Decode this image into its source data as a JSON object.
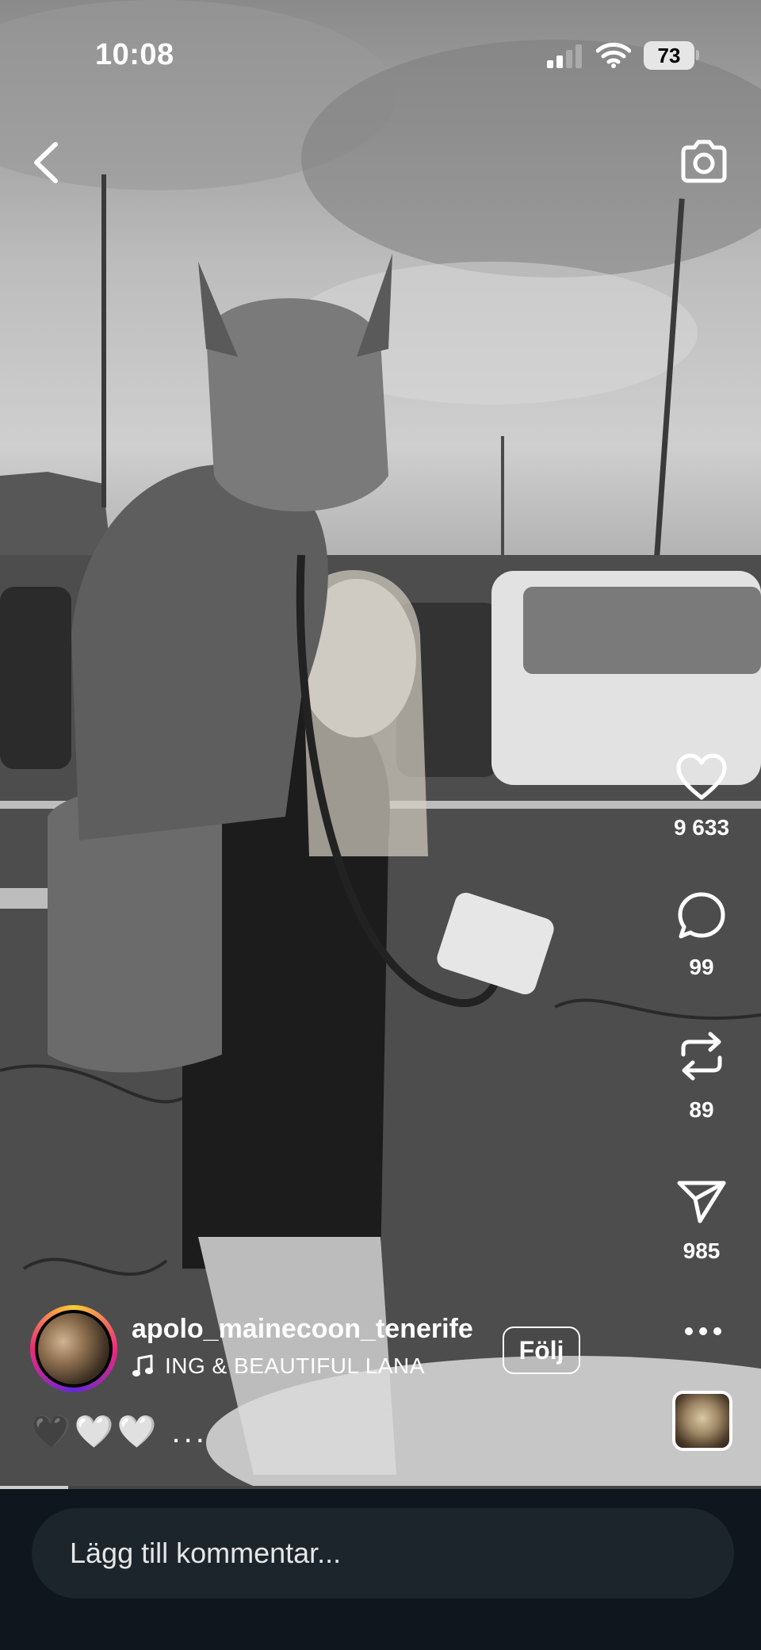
{
  "status_bar": {
    "time": "10:08",
    "battery": "73"
  },
  "icons": {
    "back": "chevron-left-icon",
    "camera": "camera-icon",
    "like": "heart-icon",
    "comment": "speech-bubble-icon",
    "repost": "repost-icon",
    "share": "paper-plane-icon",
    "more": "ellipsis-icon",
    "music": "music-note-icon"
  },
  "actions": {
    "likes": "9 633",
    "comments": "99",
    "reposts": "89",
    "shares": "985"
  },
  "post": {
    "username": "apolo_mainecoon_tenerife",
    "audio": "ING & BEAUTIFUL LANA",
    "follow_label": "Följ",
    "caption": "🖤🤍🤍 ..."
  },
  "progress": {
    "fraction": 0.09
  },
  "comment": {
    "placeholder": "Lägg till kommentar..."
  }
}
